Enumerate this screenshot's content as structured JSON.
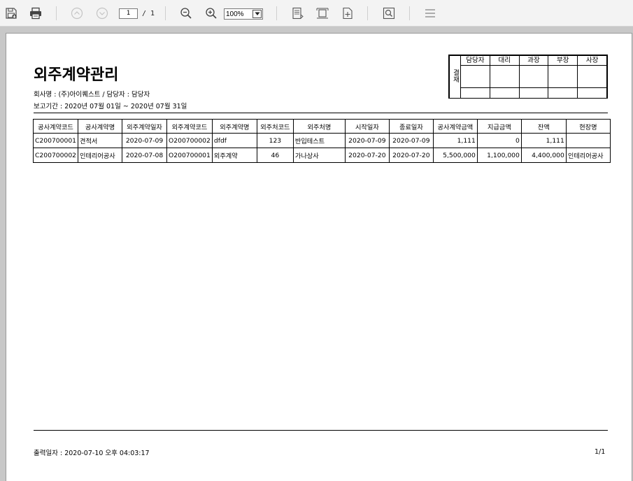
{
  "toolbar": {
    "page_current": "1",
    "page_total": "/ 1",
    "zoom": "100%"
  },
  "report": {
    "title": "외주계약관리",
    "company_line": "회사명 : (주)아이퀘스트 / 담당자 : 담당자",
    "period_line": "보고기간 : 2020년 07월 01일  ~ 2020년 07월 31일"
  },
  "approval": {
    "side_label": "결재",
    "roles": [
      "담당자",
      "대리",
      "과장",
      "부장",
      "사장"
    ]
  },
  "table": {
    "headers": [
      "공사계약코드",
      "공사계약명",
      "외주계약일자",
      "외주계약코드",
      "외주계약명",
      "외주처코드",
      "외주처명",
      "시작일자",
      "종료일자",
      "공사계약금액",
      "지급금액",
      "잔액",
      "현장명"
    ],
    "rows": [
      [
        "C200700001",
        "견적서",
        "2020-07-09",
        "O200700002",
        "dfdf",
        "123",
        "반입테스트",
        "2020-07-09",
        "2020-07-09",
        "1,111",
        "0",
        "1,111",
        ""
      ],
      [
        "C200700002",
        "인테리어공사",
        "2020-07-08",
        "O200700001",
        "외주계약",
        "46",
        "가나상사",
        "2020-07-20",
        "2020-07-20",
        "5,500,000",
        "1,100,000",
        "4,400,000",
        "인테리어공사"
      ]
    ]
  },
  "footer": {
    "printed": "출력일자 : 2020-07-10   오후  04:03:17",
    "page": "1/1"
  },
  "icons": {
    "save": "save-icon",
    "print": "print-icon",
    "prev": "chevron-up-icon",
    "next": "chevron-down-icon",
    "zoom_out": "zoom-out-icon",
    "zoom_in": "zoom-in-icon",
    "fit_page": "fit-page-icon",
    "fit_width": "fit-width-icon",
    "add_page": "page-add-icon",
    "find": "search-icon",
    "menu": "menu-icon"
  }
}
